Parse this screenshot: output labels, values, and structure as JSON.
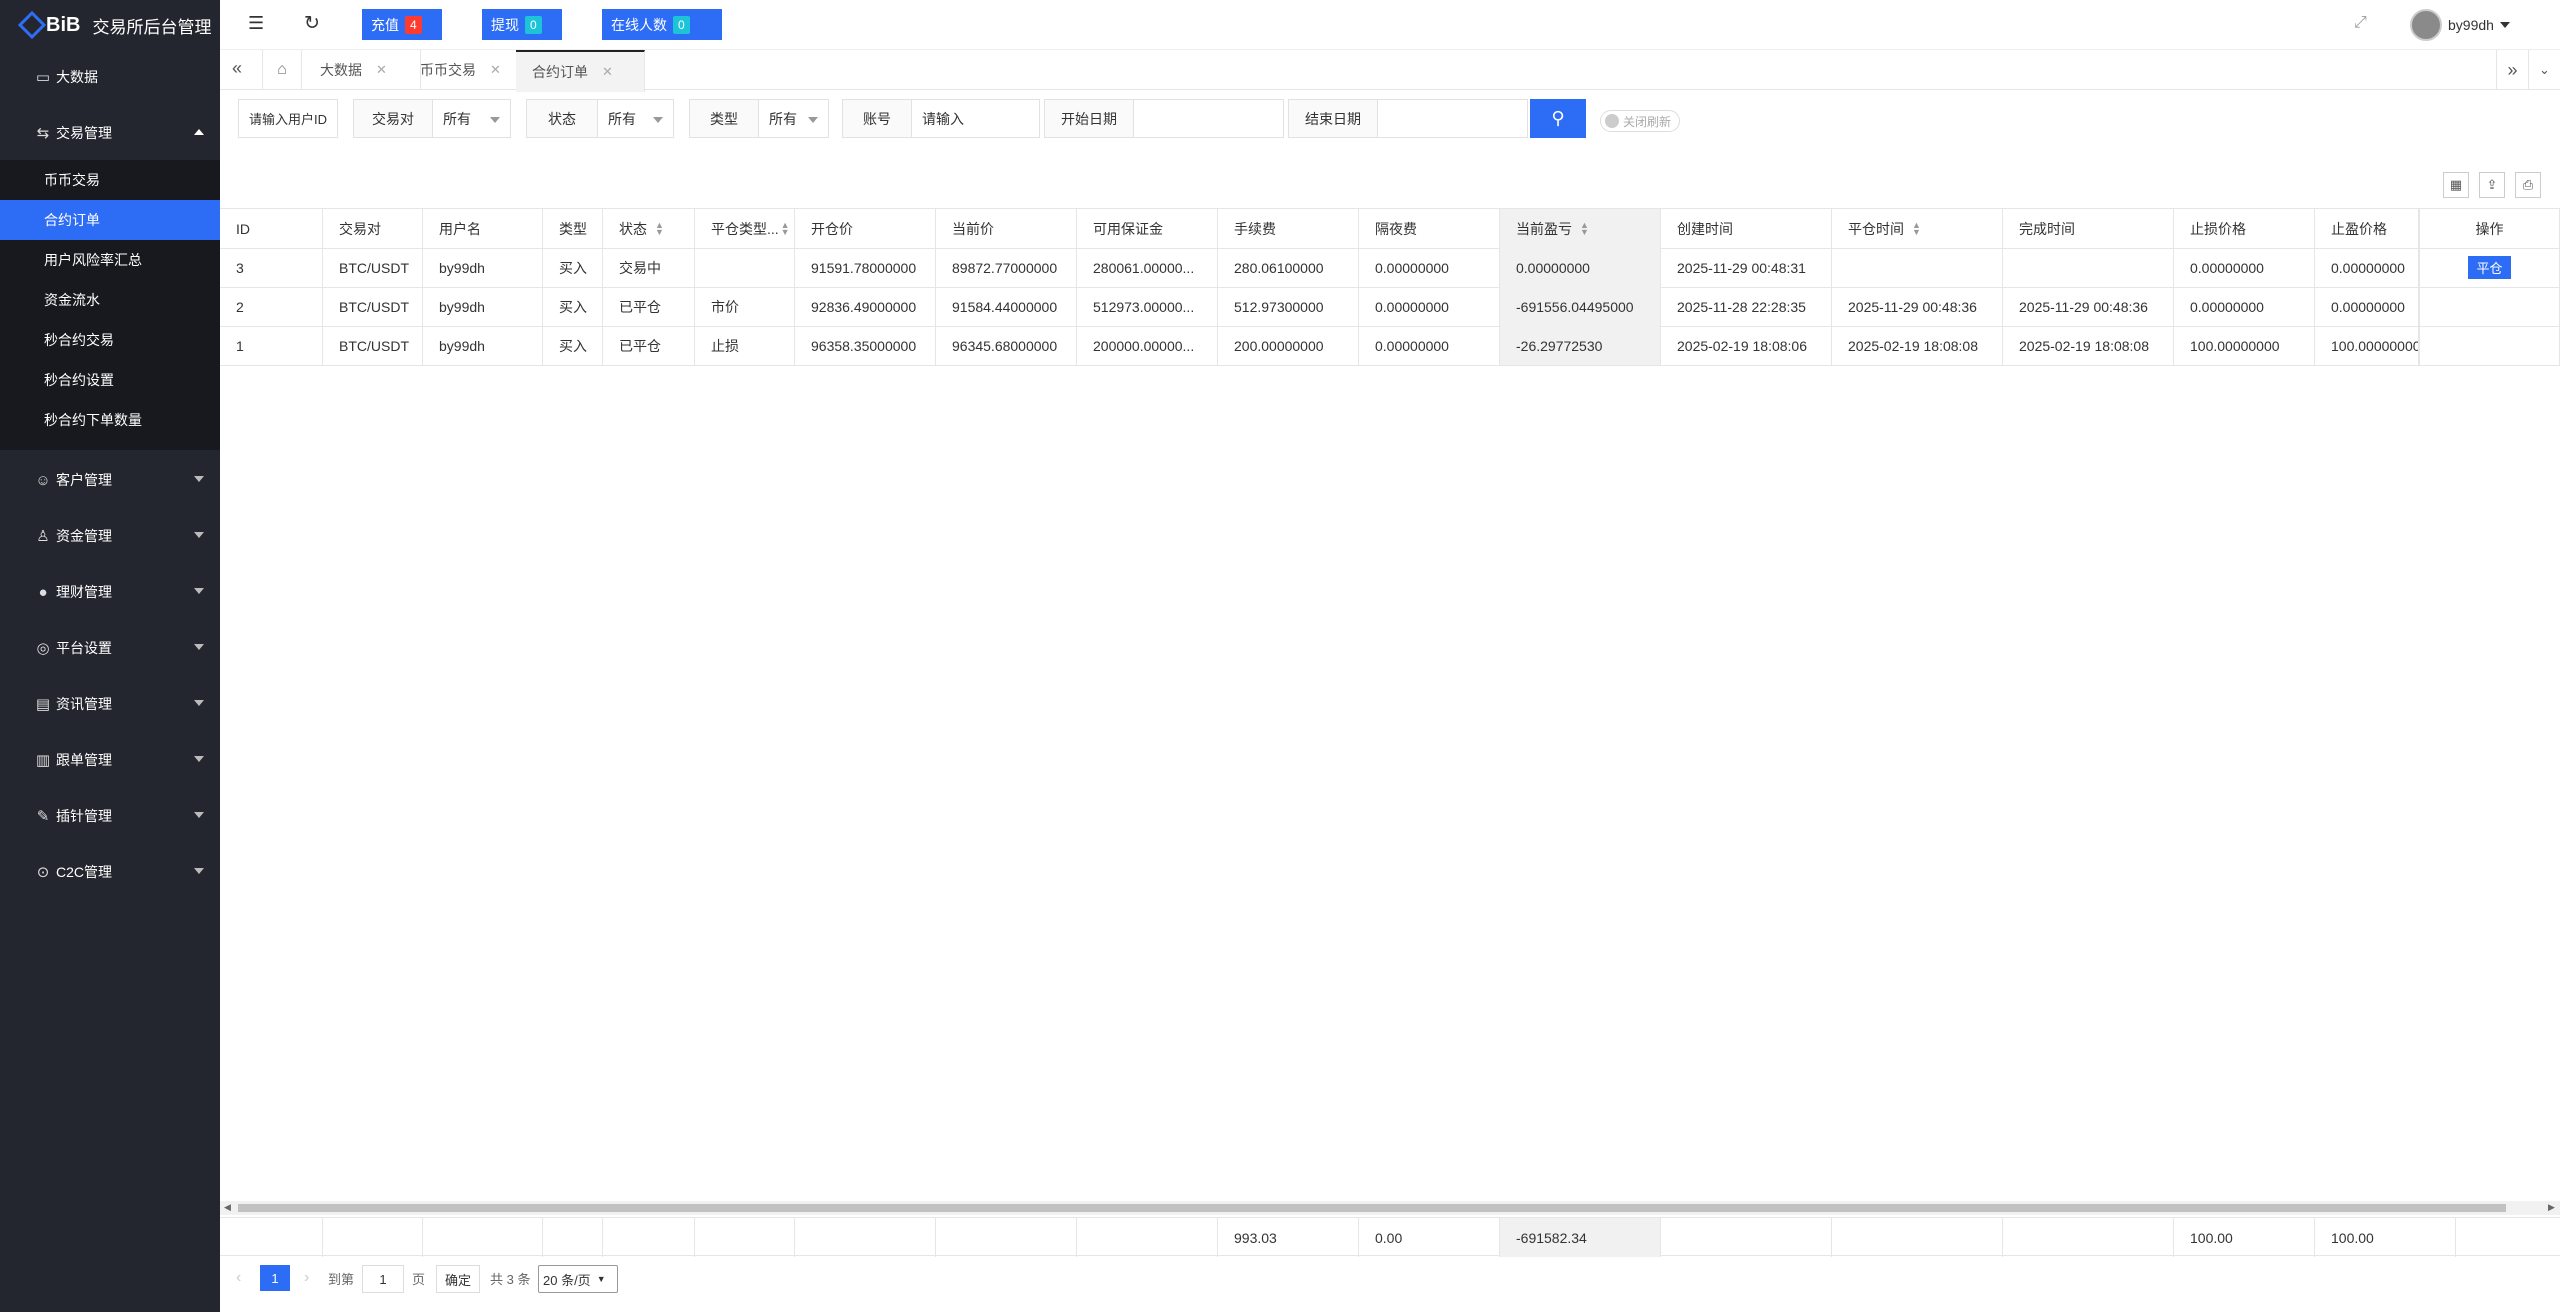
{
  "app": {
    "logo_text": "BiB",
    "title": "交易所后台管理"
  },
  "sidebar": {
    "items": [
      {
        "label": "大数据",
        "icon": "monitor-icon"
      },
      {
        "label": "交易管理",
        "icon": "exchange-icon",
        "expanded": true
      },
      {
        "label": "客户管理",
        "icon": "users-icon"
      },
      {
        "label": "资金管理",
        "icon": "money-bag-icon"
      },
      {
        "label": "理财管理",
        "icon": "piggy-bank-icon"
      },
      {
        "label": "平台设置",
        "icon": "settings-circle-icon"
      },
      {
        "label": "资讯管理",
        "icon": "news-icon"
      },
      {
        "label": "跟单管理",
        "icon": "document-icon"
      },
      {
        "label": "插针管理",
        "icon": "wrench-icon"
      },
      {
        "label": "C2C管理",
        "icon": "target-icon"
      }
    ],
    "submenu": [
      "币币交易",
      "合约订单",
      "用户风险率汇总",
      "资金流水",
      "秒合约交易",
      "秒合约设置",
      "秒合约下单数量"
    ],
    "active_submenu": "合约订单"
  },
  "header": {
    "recharge_label": "充值",
    "recharge_count": "4",
    "withdraw_label": "提现",
    "withdraw_count": "0",
    "online_label": "在线人数",
    "online_count": "0",
    "username": "by99dh",
    "colors": {
      "primary": "#2d6cf4",
      "badge_red": "#ff3b30",
      "badge_cyan": "#1cc4d8"
    }
  },
  "tabs": [
    {
      "label": "大数据"
    },
    {
      "label": "币币交易"
    },
    {
      "label": "合约订单",
      "active": true
    }
  ],
  "filters": {
    "user_id_placeholder": "请输入用户ID",
    "pair_label": "交易对",
    "pair_value": "所有",
    "status_label": "状态",
    "status_value": "所有",
    "type_label": "类型",
    "type_value": "所有",
    "account_label": "账号",
    "account_placeholder": "请输入",
    "start_date_label": "开始日期",
    "end_date_label": "结束日期",
    "toggle_label": "关闭刷新"
  },
  "table": {
    "columns": [
      "ID",
      "交易对",
      "用户名",
      "类型",
      "状态",
      "平仓类型...",
      "开仓价",
      "当前价",
      "可用保证金",
      "手续费",
      "隔夜费",
      "当前盈亏",
      "创建时间",
      "平仓时间",
      "完成时间",
      "止损价格",
      "止盈价格",
      "操作"
    ],
    "rows": [
      [
        "3",
        "BTC/USDT",
        "by99dh",
        "买入",
        "交易中",
        "",
        "91591.78000000",
        "89872.77000000",
        "280061.00000...",
        "280.06100000",
        "0.00000000",
        "0.00000000",
        "2025-11-29 00:48:31",
        "",
        "",
        "0.00000000",
        "0.00000000",
        "平仓"
      ],
      [
        "2",
        "BTC/USDT",
        "by99dh",
        "买入",
        "已平仓",
        "市价",
        "92836.49000000",
        "91584.44000000",
        "512973.00000...",
        "512.97300000",
        "0.00000000",
        "-691556.04495000",
        "2025-11-28 22:28:35",
        "2025-11-29 00:48:36",
        "2025-11-29 00:48:36",
        "0.00000000",
        "0.00000000",
        ""
      ],
      [
        "1",
        "BTC/USDT",
        "by99dh",
        "买入",
        "已平仓",
        "止损",
        "96358.35000000",
        "96345.68000000",
        "200000.00000...",
        "200.00000000",
        "0.00000000",
        "-26.29772530",
        "2025-02-19 18:08:06",
        "2025-02-19 18:08:08",
        "2025-02-19 18:08:08",
        "100.00000000",
        "100.00000000",
        ""
      ]
    ],
    "totals": {
      "fee": "993.03",
      "overnight": "0.00",
      "pnl": "-691582.34",
      "stop_loss": "100.00",
      "take_profit": "100.00"
    }
  },
  "pagination": {
    "current_page": "1",
    "goto_label": "到第",
    "goto_value": "1",
    "page_unit": "页",
    "confirm_label": "确定",
    "total_label": "共 3 条",
    "page_size": "20 条/页"
  }
}
